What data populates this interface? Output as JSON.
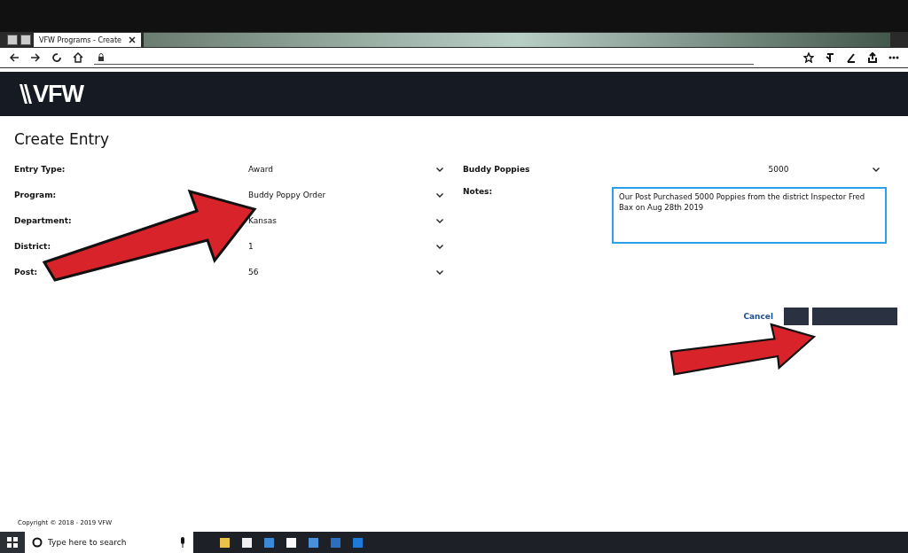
{
  "browser": {
    "tab_title": "VFW Programs - Create"
  },
  "header": {
    "logo": "VFW"
  },
  "page": {
    "title": "Create Entry"
  },
  "form_left": [
    {
      "label": "Entry Type:",
      "value": "Award"
    },
    {
      "label": "Program:",
      "value": "Buddy Poppy Order"
    },
    {
      "label": "Department:",
      "value": "Kansas"
    },
    {
      "label": "District:",
      "value": "1"
    },
    {
      "label": "Post:",
      "value": "56"
    }
  ],
  "form_right": {
    "buddy_poppies": {
      "label": "Buddy Poppies",
      "value": "5000"
    },
    "notes": {
      "label": "Notes:",
      "value": "Our Post Purchased 5000 Poppies from the district Inspector Fred Bax on Aug 28th 2019",
      "focused": true
    }
  },
  "buttons": [
    {
      "kind": "link",
      "label": "Cancel"
    },
    {
      "kind": "dark"
    },
    {
      "kind": "dark"
    }
  ],
  "annotations": [
    {
      "kind": "arrow"
    },
    {
      "kind": "arrow"
    }
  ],
  "footer": {
    "copyright": "Copyright © 2018 - 2019 VFW"
  },
  "taskbar": {
    "search_placeholder": "Type here to search"
  }
}
